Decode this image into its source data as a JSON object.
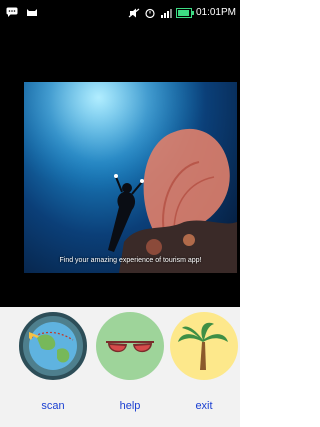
{
  "status_bar": {
    "time": "01:01PM",
    "left_icons": [
      "message-icon",
      "cat-icon"
    ],
    "right_icons": [
      "mute-icon",
      "alarm-icon",
      "signal-icon",
      "battery-icon"
    ]
  },
  "hero": {
    "tagline": "Find your amazing experience of tourism app!"
  },
  "menu": {
    "items": [
      {
        "label": "scan",
        "icon": "globe-airplane-icon"
      },
      {
        "label": "help",
        "icon": "sunglasses-icon"
      },
      {
        "label": "exit",
        "icon": "palm-tree-icon"
      }
    ]
  },
  "colors": {
    "menu_label": "#1a3fd1",
    "scan_bg": "#4e7f8d",
    "help_bg": "#9ed49a",
    "exit_bg": "#fde88b"
  }
}
